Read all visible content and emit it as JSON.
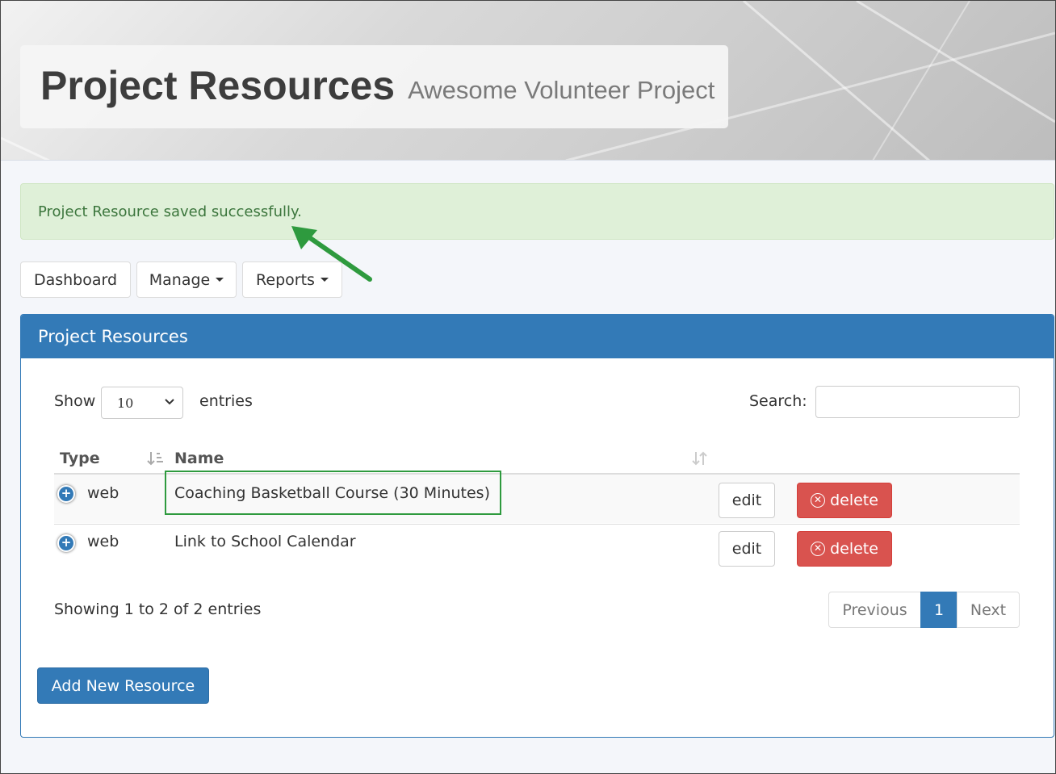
{
  "header": {
    "title": "Project Resources",
    "subtitle": "Awesome Volunteer Project"
  },
  "alert": {
    "message": "Project Resource saved successfully."
  },
  "nav": {
    "dashboard": "Dashboard",
    "manage": "Manage",
    "reports": "Reports"
  },
  "panel": {
    "title": "Project Resources",
    "show_label": "Show",
    "page_size": "10",
    "entries_label": "entries",
    "search_label": "Search:",
    "search_value": "",
    "columns": [
      "Type",
      "Name"
    ],
    "rows": [
      {
        "type": "web",
        "name": "Coaching Basketball Course (30 Minutes)",
        "edit": "edit",
        "delete": "delete"
      },
      {
        "type": "web",
        "name": "Link to School Calendar",
        "edit": "edit",
        "delete": "delete"
      }
    ],
    "info": "Showing 1 to 2 of 2 entries",
    "pagination": {
      "previous": "Previous",
      "current": "1",
      "next": "Next"
    },
    "add_button": "Add New Resource"
  },
  "colors": {
    "primary": "#337ab7",
    "danger": "#d9534f",
    "success_bg": "#dff0d8",
    "success_text": "#3c763d",
    "annotation": "#2e9a3e"
  }
}
